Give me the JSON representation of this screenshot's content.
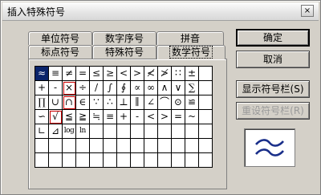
{
  "window": {
    "title": "插入特殊符号",
    "close_glyph": "×"
  },
  "tabs": {
    "row_back": [
      "单位符号",
      "数字序号",
      "拼音"
    ],
    "row_front": [
      "标点符号",
      "特殊符号",
      "数学符号"
    ],
    "active": "数学符号"
  },
  "symbols": [
    [
      "≈",
      "≡",
      "≠",
      "=",
      "≤",
      "≥",
      "<",
      ">",
      "≮",
      "≯",
      "∷",
      "±",
      ""
    ],
    [
      "+",
      "-",
      "×",
      "÷",
      "/",
      "∫",
      "∮",
      "∝",
      "∞",
      "∧",
      "∨",
      "∑",
      ""
    ],
    [
      "∏",
      "∪",
      "∩",
      "∈",
      "∵",
      "∴",
      "⊥",
      "∥",
      "∠",
      "⌒",
      "⊙",
      "≌",
      ""
    ],
    [
      "∽",
      "√",
      "≦",
      "≧",
      "≒",
      "≡",
      "+",
      "-",
      "<",
      ">",
      "=",
      "~",
      ""
    ],
    [
      "∟",
      "⊿",
      "log",
      "ln",
      "",
      "",
      "",
      "",
      "",
      "",
      "",
      "",
      ""
    ],
    [
      "",
      "",
      "",
      "",
      "",
      "",
      "",
      "",
      "",
      "",
      "",
      "",
      ""
    ],
    [
      "",
      "",
      "",
      "",
      "",
      "",
      "",
      "",
      "",
      "",
      "",
      "",
      ""
    ]
  ],
  "selected_symbol": "≈",
  "buttons": {
    "ok": "确定",
    "cancel": "取消",
    "show_bar": "显示符号栏",
    "show_bar_key": "(S)",
    "reset_bar": "重设符号栏",
    "reset_bar_key": "(R)"
  },
  "colors": {
    "selection": "#0a246a",
    "preview_glyph": "#1a2f8a"
  }
}
